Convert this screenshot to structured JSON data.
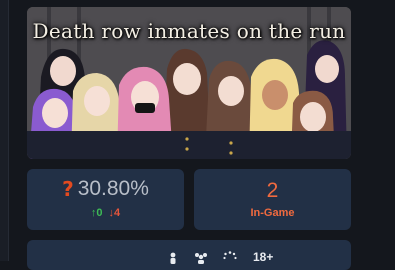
{
  "game": {
    "title": "Death row inmates on the run",
    "rating": {
      "percent": "30.80%",
      "upvotes": "↑0",
      "downvotes": "↓4"
    },
    "in_game": {
      "count": "2",
      "label": "In-Game"
    },
    "tags": {
      "icons": [
        "person-icon",
        "group-icon",
        "loading-icon"
      ],
      "age_rating": "18+"
    }
  },
  "colors": {
    "background": "#14171d",
    "card": "#223046",
    "accent_orange": "#f06a3f",
    "upvote_green": "#3dbb55",
    "downvote_red": "#e4553b",
    "rating_gray": "#b8bec8"
  }
}
